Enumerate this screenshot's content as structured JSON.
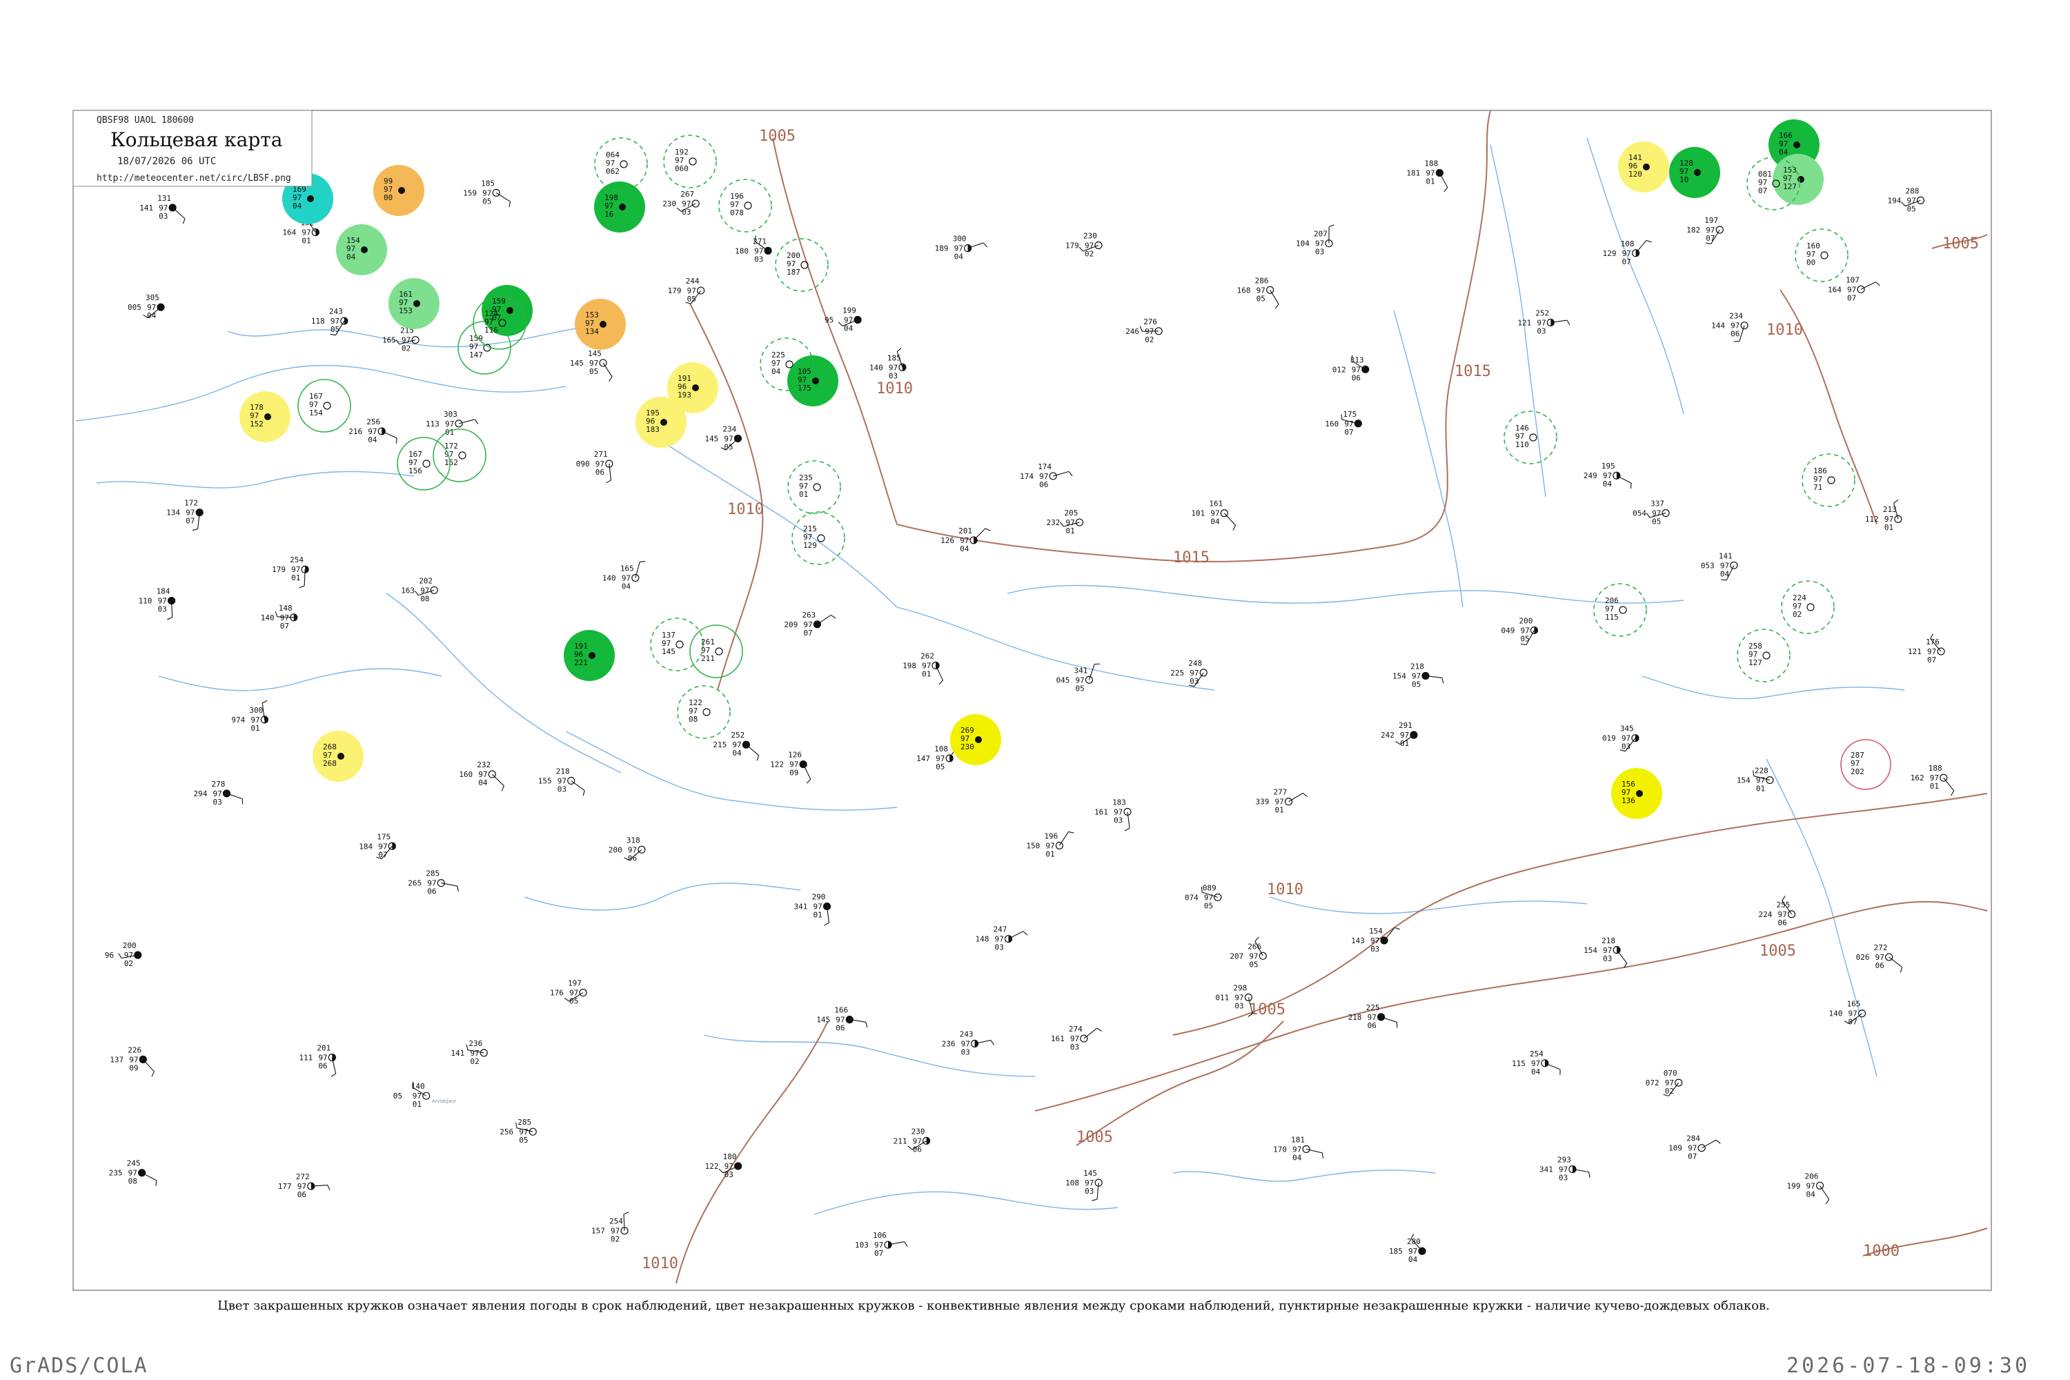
{
  "header": {
    "code": "QBSF98  UAOL  180600",
    "title": "Кольцевая карта",
    "datetime": "18/07/2026 06 UTC",
    "url": "http://meteocenter.net/circ/LBSF.png"
  },
  "isobar_labels": [
    {
      "text": "1005"
    },
    {
      "text": "1010"
    },
    {
      "text": "1010"
    },
    {
      "text": "1015"
    },
    {
      "text": "1015"
    },
    {
      "text": "1010"
    },
    {
      "text": "1005"
    },
    {
      "text": "1005"
    },
    {
      "text": "1005"
    },
    {
      "text": "1010"
    },
    {
      "text": "1000"
    },
    {
      "text": "1010"
    },
    {
      "text": "1005"
    }
  ],
  "filled_circles": [
    {
      "color": "#22d3c5",
      "values": [
        "169",
        "97",
        "04"
      ]
    },
    {
      "color": "#f5b856",
      "values": [
        "99",
        "97",
        "00"
      ]
    },
    {
      "color": "#7ee08f",
      "values": [
        "154",
        "97",
        "04"
      ]
    },
    {
      "color": "#7ee08f",
      "values": [
        "161",
        "97",
        "153"
      ]
    },
    {
      "color": "#14b83a",
      "values": [
        "159",
        "97",
        "07"
      ]
    },
    {
      "color": "#f5b856",
      "values": [
        "153",
        "97",
        "134"
      ]
    },
    {
      "color": "#14b83a",
      "values": [
        "198",
        "97",
        "16"
      ]
    },
    {
      "color": "#fbf274",
      "values": [
        "178",
        "97",
        "152"
      ]
    },
    {
      "color": "#fbf274",
      "values": [
        "191",
        "96",
        "193"
      ]
    },
    {
      "color": "#fbf274",
      "values": [
        "195",
        "96",
        "183"
      ]
    },
    {
      "color": "#14b83a",
      "values": [
        "105",
        "97",
        "175"
      ]
    },
    {
      "color": "#14b83a",
      "values": [
        "191",
        "96",
        "221"
      ]
    },
    {
      "color": "#fbf274",
      "values": [
        "268",
        "97",
        "268"
      ]
    },
    {
      "color": "#f2f200",
      "values": [
        "269",
        "97",
        "230"
      ]
    },
    {
      "color": "#fbf274",
      "values": [
        "141",
        "96",
        "120"
      ]
    },
    {
      "color": "#14b83a",
      "values": [
        "128",
        "97",
        "10"
      ]
    },
    {
      "color": "#14b83a",
      "values": [
        "166",
        "97",
        "04"
      ]
    },
    {
      "color": "#7ee08f",
      "values": [
        "153",
        "97",
        "127"
      ]
    },
    {
      "color": "#f2f200",
      "values": [
        "156",
        "97",
        "136"
      ]
    }
  ],
  "dashed_circles": [
    {
      "values": [
        "064",
        "97",
        "062"
      ]
    },
    {
      "values": [
        "192",
        "97",
        "060"
      ]
    },
    {
      "values": [
        "196",
        "97",
        "078"
      ]
    },
    {
      "values": [
        "200",
        "97",
        "187"
      ]
    },
    {
      "values": [
        "225",
        "97",
        "04"
      ]
    },
    {
      "values": [
        "235",
        "97",
        "01"
      ]
    },
    {
      "values": [
        "215",
        "97",
        "129"
      ]
    },
    {
      "values": [
        "137",
        "97",
        "145"
      ]
    },
    {
      "values": [
        "122",
        "97",
        "08"
      ]
    },
    {
      "values": [
        "160",
        "97",
        "00"
      ]
    },
    {
      "values": [
        "206",
        "97",
        "115"
      ]
    },
    {
      "values": [
        "186",
        "97",
        "71"
      ]
    },
    {
      "values": [
        "224",
        "97",
        "02"
      ]
    },
    {
      "values": [
        "258",
        "97",
        "127"
      ]
    },
    {
      "values": [
        "146",
        "97",
        "110"
      ]
    },
    {
      "values": [
        "081",
        "97",
        "07"
      ]
    }
  ],
  "open_circles": [
    {
      "values": [
        "167",
        "97",
        "154"
      ]
    },
    {
      "values": [
        "172",
        "97",
        "152"
      ]
    },
    {
      "values": [
        "167",
        "97",
        "156"
      ]
    },
    {
      "values": [
        "159",
        "97",
        "147"
      ]
    },
    {
      "values": [
        "124",
        "97",
        "116"
      ]
    },
    {
      "values": [
        "261",
        "97",
        "211"
      ]
    }
  ],
  "red_circles": [
    {
      "values": [
        "287",
        "97",
        "202"
      ]
    }
  ],
  "station_plots": [
    {
      "p": "131",
      "t": "97",
      "d": "03",
      "name": "",
      "lbl": "141"
    },
    {
      "p": "148",
      "t": "97",
      "d": "07",
      "name": "",
      "lbl": "140"
    },
    {
      "p": "140",
      "t": "97",
      "d": "01",
      "name": "Arvidsjaur",
      "lbl": "05"
    },
    {
      "p": "145",
      "t": "97",
      "d": "05",
      "name": "",
      "lbl": "145"
    },
    {
      "p": "126",
      "t": "97",
      "d": "09",
      "name": "",
      "lbl": "122"
    },
    {
      "p": "106",
      "t": "97",
      "d": "07",
      "name": "",
      "lbl": "103"
    },
    {
      "p": "174",
      "t": "97",
      "d": "06",
      "name": "",
      "lbl": "174"
    },
    {
      "p": "089",
      "t": "97",
      "d": "05",
      "name": "",
      "lbl": "074"
    },
    {
      "p": "188",
      "t": "97",
      "d": "01",
      "name": "",
      "lbl": "181"
    },
    {
      "p": "200",
      "t": "97",
      "d": "05",
      "name": "",
      "lbl": "049"
    },
    {
      "p": "070",
      "t": "97",
      "d": "02",
      "name": "",
      "lbl": "072"
    },
    {
      "p": "107",
      "t": "97",
      "d": "07",
      "name": "",
      "lbl": "164"
    },
    {
      "p": "200",
      "t": "97",
      "d": "02",
      "name": "",
      "lbl": "96"
    },
    {
      "p": "152",
      "t": "97",
      "d": "01",
      "name": "",
      "lbl": "164"
    },
    {
      "p": "202",
      "t": "97",
      "d": "08",
      "name": "",
      "lbl": "163"
    },
    {
      "p": "197",
      "t": "97",
      "d": "05",
      "name": "",
      "lbl": "176"
    },
    {
      "p": "199",
      "t": "97",
      "d": "04",
      "name": "",
      "lbl": "95"
    },
    {
      "p": "108",
      "t": "97",
      "d": "05",
      "name": "",
      "lbl": "147"
    },
    {
      "p": "145",
      "t": "97",
      "d": "03",
      "name": "",
      "lbl": "108"
    },
    {
      "p": "161",
      "t": "97",
      "d": "04",
      "name": "",
      "lbl": "101"
    },
    {
      "p": "154",
      "t": "97",
      "d": "03",
      "name": "",
      "lbl": "143"
    },
    {
      "p": "108",
      "t": "97",
      "d": "07",
      "name": "",
      "lbl": "129"
    },
    {
      "p": "141",
      "t": "97",
      "d": "04",
      "name": "",
      "lbl": "053"
    },
    {
      "p": "165",
      "t": "97",
      "d": "07",
      "name": "",
      "lbl": "140"
    },
    {
      "p": "172",
      "t": "97",
      "d": "07",
      "name": "",
      "lbl": "134"
    },
    {
      "p": "175",
      "t": "97",
      "d": "07",
      "name": "",
      "lbl": "184"
    },
    {
      "p": "185",
      "t": "97",
      "d": "05",
      "name": "",
      "lbl": "159"
    },
    {
      "p": "165",
      "t": "97",
      "d": "04",
      "name": "",
      "lbl": "140"
    },
    {
      "p": "166",
      "t": "97",
      "d": "06",
      "name": "",
      "lbl": "145"
    },
    {
      "p": "185",
      "t": "97",
      "d": "03",
      "name": "",
      "lbl": "140"
    },
    {
      "p": "183",
      "t": "97",
      "d": "03",
      "name": "",
      "lbl": "161"
    },
    {
      "p": "181",
      "t": "97",
      "d": "04",
      "name": "",
      "lbl": "170"
    },
    {
      "p": "175",
      "t": "97",
      "d": "07",
      "name": "",
      "lbl": "160"
    },
    {
      "p": "218",
      "t": "97",
      "d": "03",
      "name": "",
      "lbl": "154"
    },
    {
      "p": "197",
      "t": "97",
      "d": "07",
      "name": "",
      "lbl": "182"
    },
    {
      "p": "176",
      "t": "97",
      "d": "07",
      "name": "",
      "lbl": "121"
    },
    {
      "p": "245",
      "t": "97",
      "d": "08",
      "name": "",
      "lbl": "235"
    },
    {
      "p": "256",
      "t": "97",
      "d": "04",
      "name": "",
      "lbl": "216"
    },
    {
      "p": "285",
      "t": "97",
      "d": "06",
      "name": "",
      "lbl": "265"
    },
    {
      "p": "267",
      "t": "97",
      "d": "03",
      "name": "",
      "lbl": "230"
    },
    {
      "p": "263",
      "t": "97",
      "d": "07",
      "name": "",
      "lbl": "209"
    },
    {
      "p": "243",
      "t": "97",
      "d": "03",
      "name": "",
      "lbl": "236"
    },
    {
      "p": "276",
      "t": "97",
      "d": "02",
      "name": "",
      "lbl": "246"
    },
    {
      "p": "277",
      "t": "97",
      "d": "01",
      "name": "",
      "lbl": "339"
    },
    {
      "p": "280",
      "t": "97",
      "d": "04",
      "name": "",
      "lbl": "185"
    },
    {
      "p": "195",
      "t": "97",
      "d": "04",
      "name": "",
      "lbl": "249"
    },
    {
      "p": "255",
      "t": "97",
      "d": "06",
      "name": "",
      "lbl": "224"
    },
    {
      "p": "288",
      "t": "97",
      "d": "05",
      "name": "",
      "lbl": "194"
    },
    {
      "p": "278",
      "t": "97",
      "d": "03",
      "name": "",
      "lbl": "294"
    },
    {
      "p": "272",
      "t": "97",
      "d": "06",
      "name": "",
      "lbl": "177"
    },
    {
      "p": "303",
      "t": "97",
      "d": "01",
      "name": "",
      "lbl": "113"
    },
    {
      "p": "318",
      "t": "97",
      "d": "06",
      "name": "",
      "lbl": "200"
    },
    {
      "p": "271",
      "t": "97",
      "d": "03",
      "name": "",
      "lbl": "180"
    },
    {
      "p": "262",
      "t": "97",
      "d": "01",
      "name": "",
      "lbl": "198"
    },
    {
      "p": "274",
      "t": "97",
      "d": "03",
      "name": "",
      "lbl": "161"
    },
    {
      "p": "286",
      "t": "97",
      "d": "05",
      "name": "",
      "lbl": "168"
    },
    {
      "p": "291",
      "t": "97",
      "d": "01",
      "name": "",
      "lbl": "242"
    },
    {
      "p": "293",
      "t": "97",
      "d": "03",
      "name": "",
      "lbl": "341"
    },
    {
      "p": "337",
      "t": "97",
      "d": "05",
      "name": "",
      "lbl": "054"
    },
    {
      "p": "272",
      "t": "97",
      "d": "06",
      "name": "",
      "lbl": "026"
    },
    {
      "p": "305",
      "t": "97",
      "d": "04",
      "name": "",
      "lbl": "005"
    },
    {
      "p": "300",
      "t": "97",
      "d": "01",
      "name": "",
      "lbl": "974"
    },
    {
      "p": "285",
      "t": "97",
      "d": "05",
      "name": "",
      "lbl": "256"
    },
    {
      "p": "271",
      "t": "97",
      "d": "06",
      "name": "",
      "lbl": "090"
    },
    {
      "p": "290",
      "t": "97",
      "d": "01",
      "name": "",
      "lbl": "341"
    },
    {
      "p": "300",
      "t": "97",
      "d": "04",
      "name": "",
      "lbl": "189"
    },
    {
      "p": "341",
      "t": "97",
      "d": "05",
      "name": "",
      "lbl": "045"
    },
    {
      "p": "298",
      "t": "97",
      "d": "03",
      "name": "",
      "lbl": "011"
    },
    {
      "p": "313",
      "t": "97",
      "d": "06",
      "name": "",
      "lbl": "012"
    },
    {
      "p": "345",
      "t": "97",
      "d": "03",
      "name": "",
      "lbl": "019"
    },
    {
      "p": "284",
      "t": "97",
      "d": "07",
      "name": "",
      "lbl": "109"
    },
    {
      "p": "213",
      "t": "97",
      "d": "01",
      "name": "",
      "lbl": "112"
    },
    {
      "p": "226",
      "t": "97",
      "d": "09",
      "name": "",
      "lbl": "137"
    },
    {
      "p": "243",
      "t": "97",
      "d": "05",
      "name": "",
      "lbl": "118"
    },
    {
      "p": "232",
      "t": "97",
      "d": "04",
      "name": "",
      "lbl": "160"
    },
    {
      "p": "254",
      "t": "97",
      "d": "02",
      "name": "",
      "lbl": "157"
    },
    {
      "p": "234",
      "t": "97",
      "d": "05",
      "name": "",
      "lbl": "145"
    },
    {
      "p": "247",
      "t": "97",
      "d": "03",
      "name": "",
      "lbl": "148"
    },
    {
      "p": "230",
      "t": "97",
      "d": "02",
      "name": "",
      "lbl": "179"
    },
    {
      "p": "248",
      "t": "97",
      "d": "03",
      "name": "",
      "lbl": "225"
    },
    {
      "p": "225",
      "t": "97",
      "d": "06",
      "name": "",
      "lbl": "218"
    },
    {
      "p": "252",
      "t": "97",
      "d": "03",
      "name": "",
      "lbl": "121"
    },
    {
      "p": "228",
      "t": "97",
      "d": "01",
      "name": "",
      "lbl": "154"
    },
    {
      "p": "206",
      "t": "97",
      "d": "04",
      "name": "",
      "lbl": "199"
    },
    {
      "p": "184",
      "t": "97",
      "d": "03",
      "name": "",
      "lbl": "110"
    },
    {
      "p": "201",
      "t": "97",
      "d": "06",
      "name": "",
      "lbl": "111"
    },
    {
      "p": "215",
      "t": "97",
      "d": "02",
      "name": "",
      "lbl": "165"
    },
    {
      "p": "218",
      "t": "97",
      "d": "03",
      "name": "",
      "lbl": "155"
    },
    {
      "p": "180",
      "t": "97",
      "d": "03",
      "name": "",
      "lbl": "122"
    },
    {
      "p": "201",
      "t": "97",
      "d": "04",
      "name": "",
      "lbl": "126"
    },
    {
      "p": "196",
      "t": "97",
      "d": "01",
      "name": "",
      "lbl": "150"
    },
    {
      "p": "207",
      "t": "97",
      "d": "03",
      "name": "",
      "lbl": "104"
    },
    {
      "p": "218",
      "t": "97",
      "d": "05",
      "name": "",
      "lbl": "154"
    },
    {
      "p": "254",
      "t": "97",
      "d": "04",
      "name": "",
      "lbl": "115"
    },
    {
      "p": "234",
      "t": "97",
      "d": "06",
      "name": "",
      "lbl": "144"
    },
    {
      "p": "188",
      "t": "97",
      "d": "01",
      "name": "",
      "lbl": "162"
    },
    {
      "p": "213",
      "t": "97",
      "d": "09",
      "name": "",
      "lbl": "190"
    },
    {
      "p": "254",
      "t": "97",
      "d": "01",
      "name": "",
      "lbl": "179"
    },
    {
      "p": "236",
      "t": "97",
      "d": "02",
      "name": "",
      "lbl": "141"
    },
    {
      "p": "244",
      "t": "97",
      "d": "05",
      "name": "",
      "lbl": "179"
    },
    {
      "p": "252",
      "t": "97",
      "d": "04",
      "name": "",
      "lbl": "215"
    },
    {
      "p": "230",
      "t": "97",
      "d": "06",
      "name": "",
      "lbl": "211"
    },
    {
      "p": "205",
      "t": "97",
      "d": "01",
      "name": "",
      "lbl": "232"
    },
    {
      "p": "266",
      "t": "97",
      "d": "05",
      "name": "",
      "lbl": "207"
    }
  ],
  "caption": "Цвет закрашенных кружков означает явления погоды в срок наблюдений, цвет незакрашенных кружков - конвективные явления между сроками наблюдений, пунктирные незакрашенные кружки - наличие кучево-дождевых облаков.",
  "footer": {
    "left": "GrADS/COLA",
    "right": "2026-07-18-09:30"
  }
}
